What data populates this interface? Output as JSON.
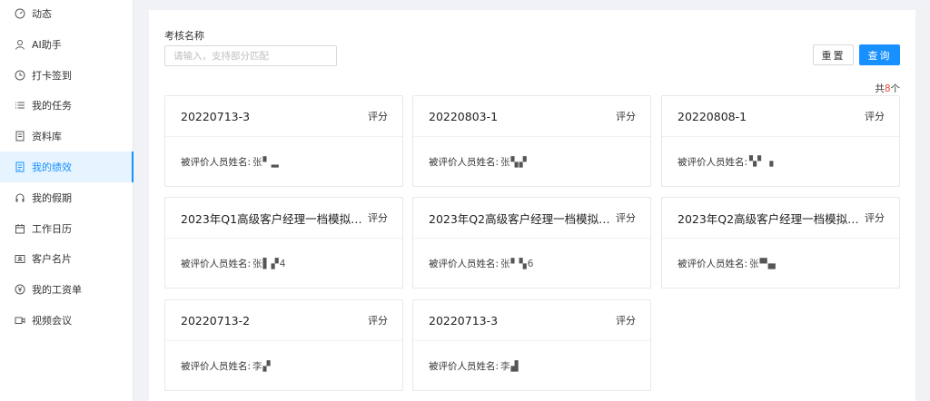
{
  "sidebar": {
    "items": [
      {
        "label": "动态",
        "icon": "dashboard-icon",
        "active": false
      },
      {
        "label": "AI助手",
        "icon": "user-icon",
        "active": false
      },
      {
        "label": "打卡签到",
        "icon": "clock-icon",
        "active": false
      },
      {
        "label": "我的任务",
        "icon": "list-icon",
        "active": false
      },
      {
        "label": "资料库",
        "icon": "document-icon",
        "active": false
      },
      {
        "label": "我的绩效",
        "icon": "report-icon",
        "active": true
      },
      {
        "label": "我的假期",
        "icon": "headphones-icon",
        "active": false
      },
      {
        "label": "工作日历",
        "icon": "calendar-icon",
        "active": false
      },
      {
        "label": "客户名片",
        "icon": "contact-card-icon",
        "active": false
      },
      {
        "label": "我的工资单",
        "icon": "yen-icon",
        "active": false
      },
      {
        "label": "视频会议",
        "icon": "video-icon",
        "active": false
      }
    ]
  },
  "filter": {
    "label": "考核名称",
    "placeholder": "请输入，支持部分匹配",
    "reset_label": "重置",
    "query_label": "查询"
  },
  "total": {
    "prefix": "共",
    "count": "8",
    "suffix": "个"
  },
  "cards": [
    {
      "title": "20220713-3",
      "action": "评分",
      "label": "被评价人员姓名:",
      "name": "张▘▂"
    },
    {
      "title": "20220803-1",
      "action": "评分",
      "label": "被评价人员姓名:",
      "name": "张▚▞"
    },
    {
      "title": "20220808-1",
      "action": "评分",
      "label": "被评价人员姓名:",
      "name": "▚▘▗"
    },
    {
      "title": "2023年Q1高级客户经理一档模拟利润...",
      "action": "评分",
      "label": "被评价人员姓名:",
      "name": "张▌▞4"
    },
    {
      "title": "2023年Q2高级客户经理一档模拟利润...",
      "action": "评分",
      "label": "被评价人员姓名:",
      "name": "张▘▚6"
    },
    {
      "title": "2023年Q2高级客户经理一档模拟利润...",
      "action": "评分",
      "label": "被评价人员姓名:",
      "name": "张▀▄"
    },
    {
      "title": "20220713-2",
      "action": "评分",
      "label": "被评价人员姓名:",
      "name": "李▞"
    },
    {
      "title": "20220713-3",
      "action": "评分",
      "label": "被评价人员姓名:",
      "name": "李▟"
    }
  ],
  "colors": {
    "accent": "#1890ff",
    "count_red": "#e8463a"
  }
}
